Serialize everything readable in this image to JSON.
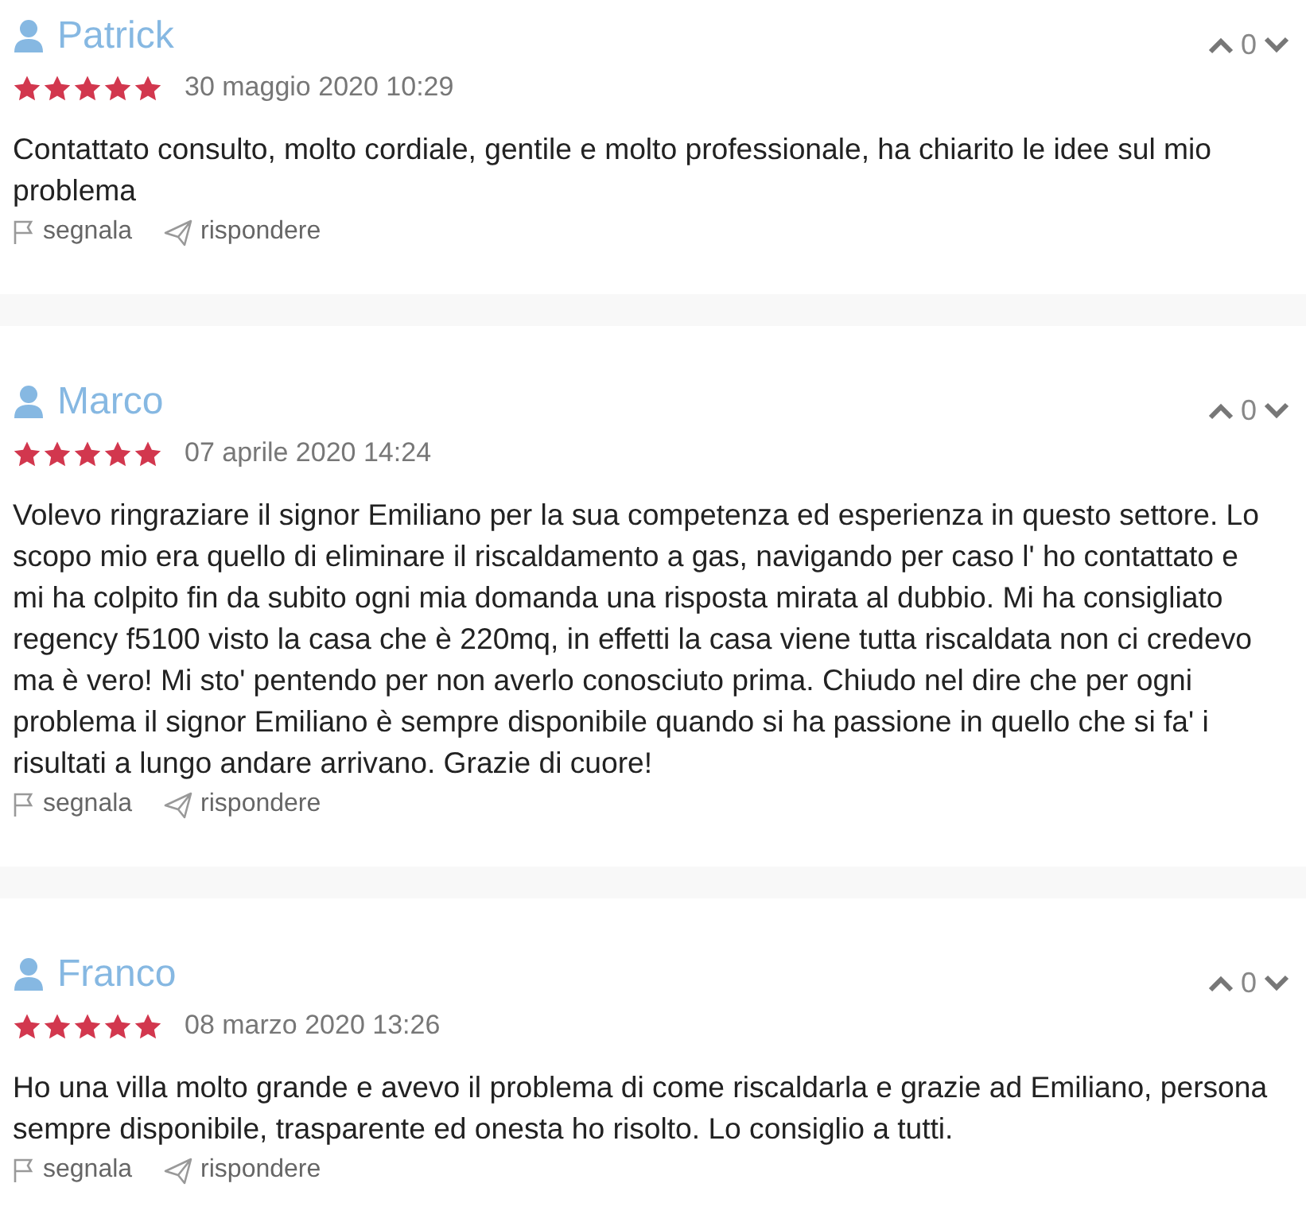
{
  "reviews": [
    {
      "author": "Patrick",
      "stars": 5,
      "date": "30 maggio 2020 10:29",
      "votes": "0",
      "text": "Contattato consulto, molto cordiale, gentile e molto professionale, ha chiarito le idee sul mio problema",
      "actions": [
        {
          "kind": "flag",
          "label": "segnala"
        },
        {
          "kind": "reply",
          "label": "rispondere"
        }
      ]
    },
    {
      "author": "Marco",
      "stars": 5,
      "date": "07 aprile 2020 14:24",
      "votes": "0",
      "text": "Volevo ringraziare il signor Emiliano per la sua competenza ed esperienza in questo settore. Lo scopo mio era quello di eliminare il riscaldamento a gas, navigando per caso l' ho contattato e mi ha colpito fin da subito ogni mia domanda una risposta mirata al dubbio. Mi ha consigliato regency f5100 visto la casa che è 220mq, in effetti la casa viene tutta riscaldata non ci credevo ma è vero! Mi sto' pentendo per non averlo conosciuto prima. Chiudo nel dire che per ogni problema il signor Emiliano è sempre disponibile quando si ha passione in quello che si fa' i risultati a lungo andare arrivano. Grazie di cuore!",
      "actions": [
        {
          "kind": "flag",
          "label": "segnala"
        },
        {
          "kind": "reply",
          "label": "rispondere"
        }
      ]
    },
    {
      "author": "Franco",
      "stars": 5,
      "date": "08 marzo 2020 13:26",
      "votes": "0",
      "text": "Ho una villa molto grande e avevo il problema di come riscaldarla e grazie ad Emiliano, persona sempre disponibile, trasparente ed onesta ho risolto. Lo consiglio a tutti.",
      "actions": [
        {
          "kind": "flag",
          "label": "segnala"
        },
        {
          "kind": "reply",
          "label": "rispondere"
        }
      ]
    }
  ]
}
